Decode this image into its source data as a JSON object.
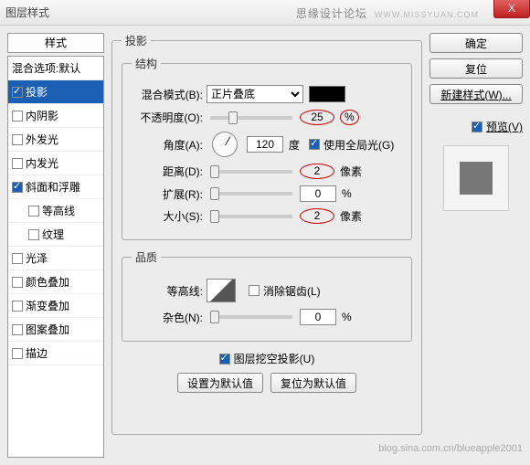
{
  "title": "图层样式",
  "watermark_right": "思缘设计论坛",
  "watermark_url": "WWW.MISSYUAN.COM",
  "close_x": "X",
  "left": {
    "header": "样式",
    "items": [
      {
        "label": "混合选项:默认",
        "checked": false,
        "sel": false,
        "nocb": true
      },
      {
        "label": "投影",
        "checked": true,
        "sel": true
      },
      {
        "label": "内阴影",
        "checked": false
      },
      {
        "label": "外发光",
        "checked": false
      },
      {
        "label": "内发光",
        "checked": false
      },
      {
        "label": "斜面和浮雕",
        "checked": true
      },
      {
        "label": "等高线",
        "checked": false,
        "indent": true
      },
      {
        "label": "纹理",
        "checked": false,
        "indent": true
      },
      {
        "label": "光泽",
        "checked": false
      },
      {
        "label": "颜色叠加",
        "checked": false
      },
      {
        "label": "渐变叠加",
        "checked": false
      },
      {
        "label": "图案叠加",
        "checked": false
      },
      {
        "label": "描边",
        "checked": false
      }
    ]
  },
  "center": {
    "outer_legend": "投影",
    "struct_legend": "结构",
    "blend_label": "混合模式(B):",
    "blend_value": "正片叠底",
    "opacity_label": "不透明度(O):",
    "opacity_value": "25",
    "opacity_unit": "%",
    "angle_label": "角度(A):",
    "angle_value": "120",
    "angle_unit": "度",
    "global_light": "使用全局光(G)",
    "distance_label": "距离(D):",
    "distance_value": "2",
    "px_unit": "像素",
    "spread_label": "扩展(R):",
    "spread_value": "0",
    "spread_unit": "%",
    "size_label": "大小(S):",
    "size_value": "2",
    "quality_legend": "品质",
    "contour_label": "等高线:",
    "antialias": "消除锯齿(L)",
    "noise_label": "杂色(N):",
    "noise_value": "0",
    "noise_unit": "%",
    "knockout": "图层挖空投影(U)",
    "reset_default": "设置为默认值",
    "restore_default": "复位为默认值"
  },
  "right": {
    "ok": "确定",
    "reset": "复位",
    "newstyle": "新建样式(W)...",
    "preview_label": "预览(V)"
  },
  "footer": "blog.sina.com.cn/blueapple2001"
}
